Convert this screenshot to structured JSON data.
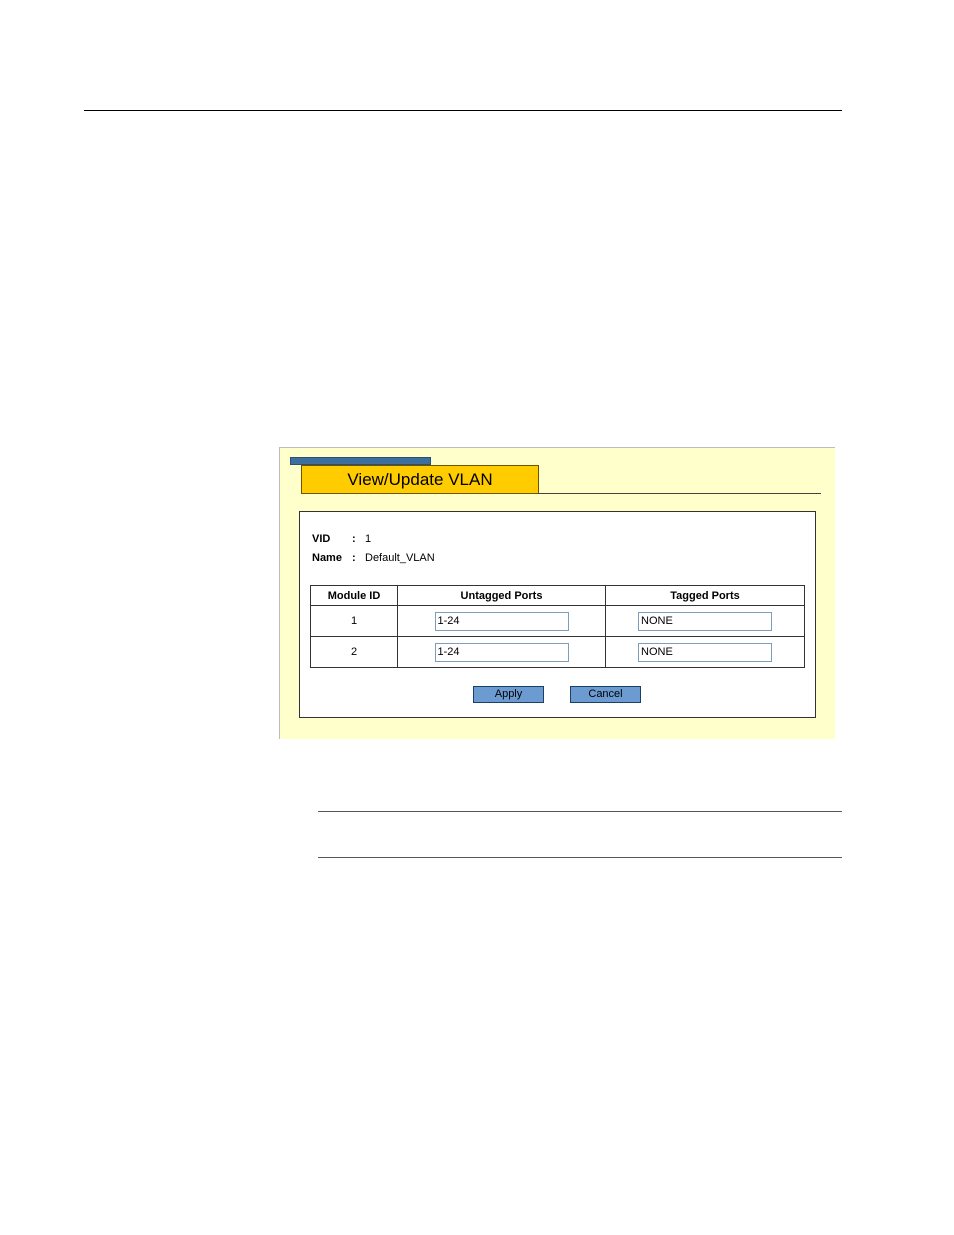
{
  "panel": {
    "title": "View/Update VLAN"
  },
  "vlan": {
    "vid_label": "VID",
    "vid_colon": ":",
    "vid_value": "1",
    "name_label": "Name",
    "name_colon": ":",
    "name_value": "Default_VLAN"
  },
  "table": {
    "headers": [
      "Module ID",
      "Untagged Ports",
      "Tagged Ports"
    ],
    "rows": [
      {
        "module_id": "1",
        "untagged": "1-24",
        "tagged": "NONE"
      },
      {
        "module_id": "2",
        "untagged": "1-24",
        "tagged": "NONE"
      }
    ]
  },
  "buttons": {
    "apply": "Apply",
    "cancel": "Cancel"
  },
  "colors": {
    "panel_bg": "#ffffcc",
    "tab_bg": "#ffcc00",
    "tab_strip": "#3c6e9e",
    "button_bg": "#6b9bd1"
  }
}
